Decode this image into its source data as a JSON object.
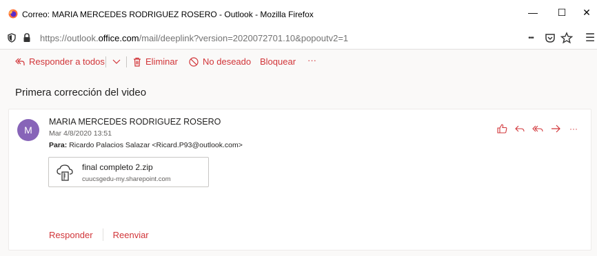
{
  "window": {
    "title": "Correo: MARIA MERCEDES RODRIGUEZ ROSERO - Outlook - Mozilla Firefox",
    "minimize": "—",
    "maximize": "☐",
    "close": "✕"
  },
  "urlbar": {
    "url_prefix": "https://outlook.",
    "url_domain": "office.com",
    "url_suffix": "/mail/deeplink?version=2020072701.10&popoutv2=1",
    "more": "•••",
    "menu": "☰"
  },
  "toolbar": {
    "reply_all_label": "Responder a todos",
    "delete_label": "Eliminar",
    "junk_label": "No deseado",
    "block_label": "Bloquear",
    "more_label": "···"
  },
  "message": {
    "subject": "Primera corrección del video",
    "avatar_initial": "M",
    "sender": "MARIA MERCEDES RODRIGUEZ ROSERO",
    "date": "Mar 4/8/2020 13:51",
    "to_label": "Para:",
    "to_value": "Ricardo Palacios Salazar <Ricard.P93@outlook.com>",
    "more_actions": "···"
  },
  "attachment": {
    "name": "final completo 2.zip",
    "source": "cuucsgedu-my.sharepoint.com"
  },
  "footer": {
    "reply_label": "Responder",
    "forward_label": "Reenviar"
  },
  "colors": {
    "accent": "#d13438",
    "avatar": "#8764b8"
  }
}
